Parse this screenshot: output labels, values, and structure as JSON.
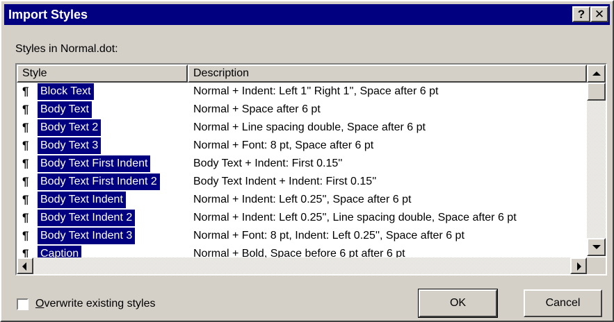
{
  "window": {
    "title": "Import Styles",
    "help_label": "?",
    "close_label": "✕"
  },
  "list_label": "Styles in Normal.dot:",
  "columns": {
    "style": "Style",
    "description": "Description"
  },
  "rows": [
    {
      "icon": "¶",
      "name": "Block Text",
      "description": "Normal + Indent:  Left  1'' Right  1'', Space  after 6 pt"
    },
    {
      "icon": "¶",
      "name": "Body Text",
      "description": "Normal + Space  after 6 pt"
    },
    {
      "icon": "¶",
      "name": "Body Text 2",
      "description": "Normal + Line spacing double, Space  after 6 pt"
    },
    {
      "icon": "¶",
      "name": "Body Text 3",
      "description": "Normal + Font: 8 pt, Space  after 6 pt"
    },
    {
      "icon": "¶",
      "name": "Body Text First Indent",
      "description": "Body Text + Indent:  First  0.15''"
    },
    {
      "icon": "¶",
      "name": "Body Text First Indent 2",
      "description": "Body Text Indent + Indent:  First  0.15''"
    },
    {
      "icon": "¶",
      "name": "Body Text Indent",
      "description": "Normal + Indent:  Left  0.25'', Space  after 6 pt"
    },
    {
      "icon": "¶",
      "name": "Body Text Indent 2",
      "description": "Normal + Indent:  Left  0.25'', Line spacing double, Space  after 6 pt"
    },
    {
      "icon": "¶",
      "name": "Body Text Indent 3",
      "description": "Normal + Font: 8 pt, Indent:  Left  0.25'', Space  after 6 pt"
    },
    {
      "icon": "¶",
      "name": "Caption",
      "description": "Normal + Bold, Space before 6 pt  after 6 pt"
    }
  ],
  "overwrite_checkbox": {
    "label": "Overwrite existing styles",
    "checked": false
  },
  "buttons": {
    "ok": "OK",
    "cancel": "Cancel"
  },
  "colors": {
    "title_bar": "#000080",
    "selection": "#000080",
    "face": "#d4d0c8"
  }
}
